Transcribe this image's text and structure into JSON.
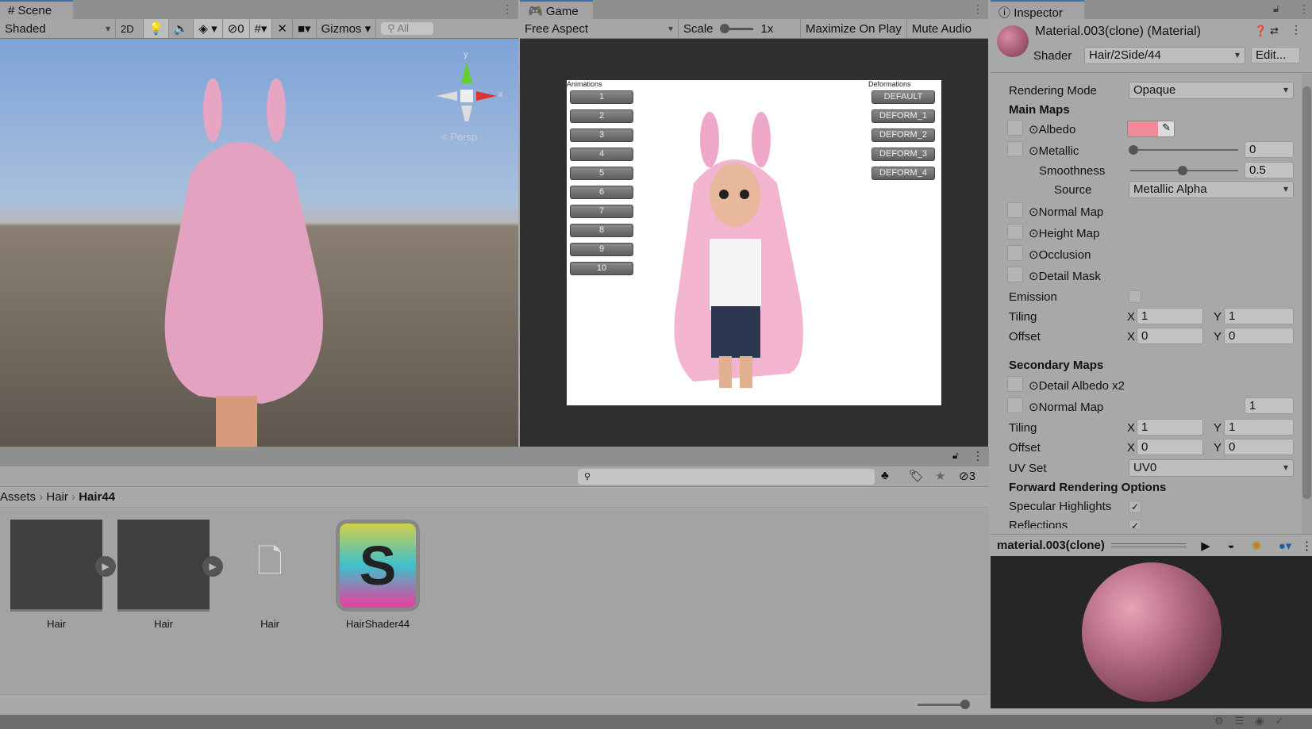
{
  "scene": {
    "tab": "Scene",
    "shading": "Shaded",
    "btn_2d": "2D",
    "hidden_count": "0",
    "gizmos": "Gizmos",
    "search_placeholder": "All",
    "persp": "< Persp",
    "axis_y": "y",
    "axis_x": "x"
  },
  "game": {
    "tab": "Game",
    "aspect": "Free Aspect",
    "scale_label": "Scale",
    "scale_value": "1x",
    "maximize": "Maximize On Play",
    "mute": "Mute Audio",
    "animations_label": "Animations",
    "deformations_label": "Deformations",
    "animations": [
      "1",
      "2",
      "3",
      "4",
      "5",
      "6",
      "7",
      "8",
      "9",
      "10"
    ],
    "deformations": [
      "DEFAULT",
      "DEFORM_1",
      "DEFORM_2",
      "DEFORM_3",
      "DEFORM_4"
    ]
  },
  "inspector": {
    "tab": "Inspector",
    "title": "Material.003(clone) (Material)",
    "shader_label": "Shader",
    "shader": "Hair/2Side/44",
    "edit": "Edit...",
    "rendering_mode_label": "Rendering Mode",
    "rendering_mode": "Opaque",
    "main_maps": "Main Maps",
    "albedo": "Albedo",
    "albedo_color": "#f28a9a",
    "metallic": "Metallic",
    "metallic_value": "0",
    "metallic_fraction": 0,
    "smoothness": "Smoothness",
    "smoothness_value": "0.5",
    "smoothness_fraction": 0.5,
    "source_label": "Source",
    "source": "Metallic Alpha",
    "normal_map": "Normal Map",
    "height_map": "Height Map",
    "occlusion": "Occlusion",
    "detail_mask": "Detail Mask",
    "emission": "Emission",
    "tiling": "Tiling",
    "offset": "Offset",
    "x": "X",
    "y": "Y",
    "main_tiling": [
      "1",
      "1"
    ],
    "main_offset": [
      "0",
      "0"
    ],
    "secondary_maps": "Secondary Maps",
    "detail_albedo": "Detail Albedo x2",
    "sec_normal_map": "Normal Map",
    "sec_normal_value": "1",
    "sec_tiling": [
      "1",
      "1"
    ],
    "sec_offset": [
      "0",
      "0"
    ],
    "uv_set_label": "UV Set",
    "uv_set": "UV0",
    "forward_options": "Forward Rendering Options",
    "specular": "Specular Highlights",
    "reflections": "Reflections",
    "preview_title": "material.003(clone)"
  },
  "project": {
    "hidden_count": "3",
    "breadcrumb": [
      "Assets",
      "Hair",
      "Hair44"
    ],
    "assets": [
      {
        "name": "Hair"
      },
      {
        "name": "Hair"
      },
      {
        "name": "Hair"
      },
      {
        "name": "HairShader44"
      }
    ]
  }
}
